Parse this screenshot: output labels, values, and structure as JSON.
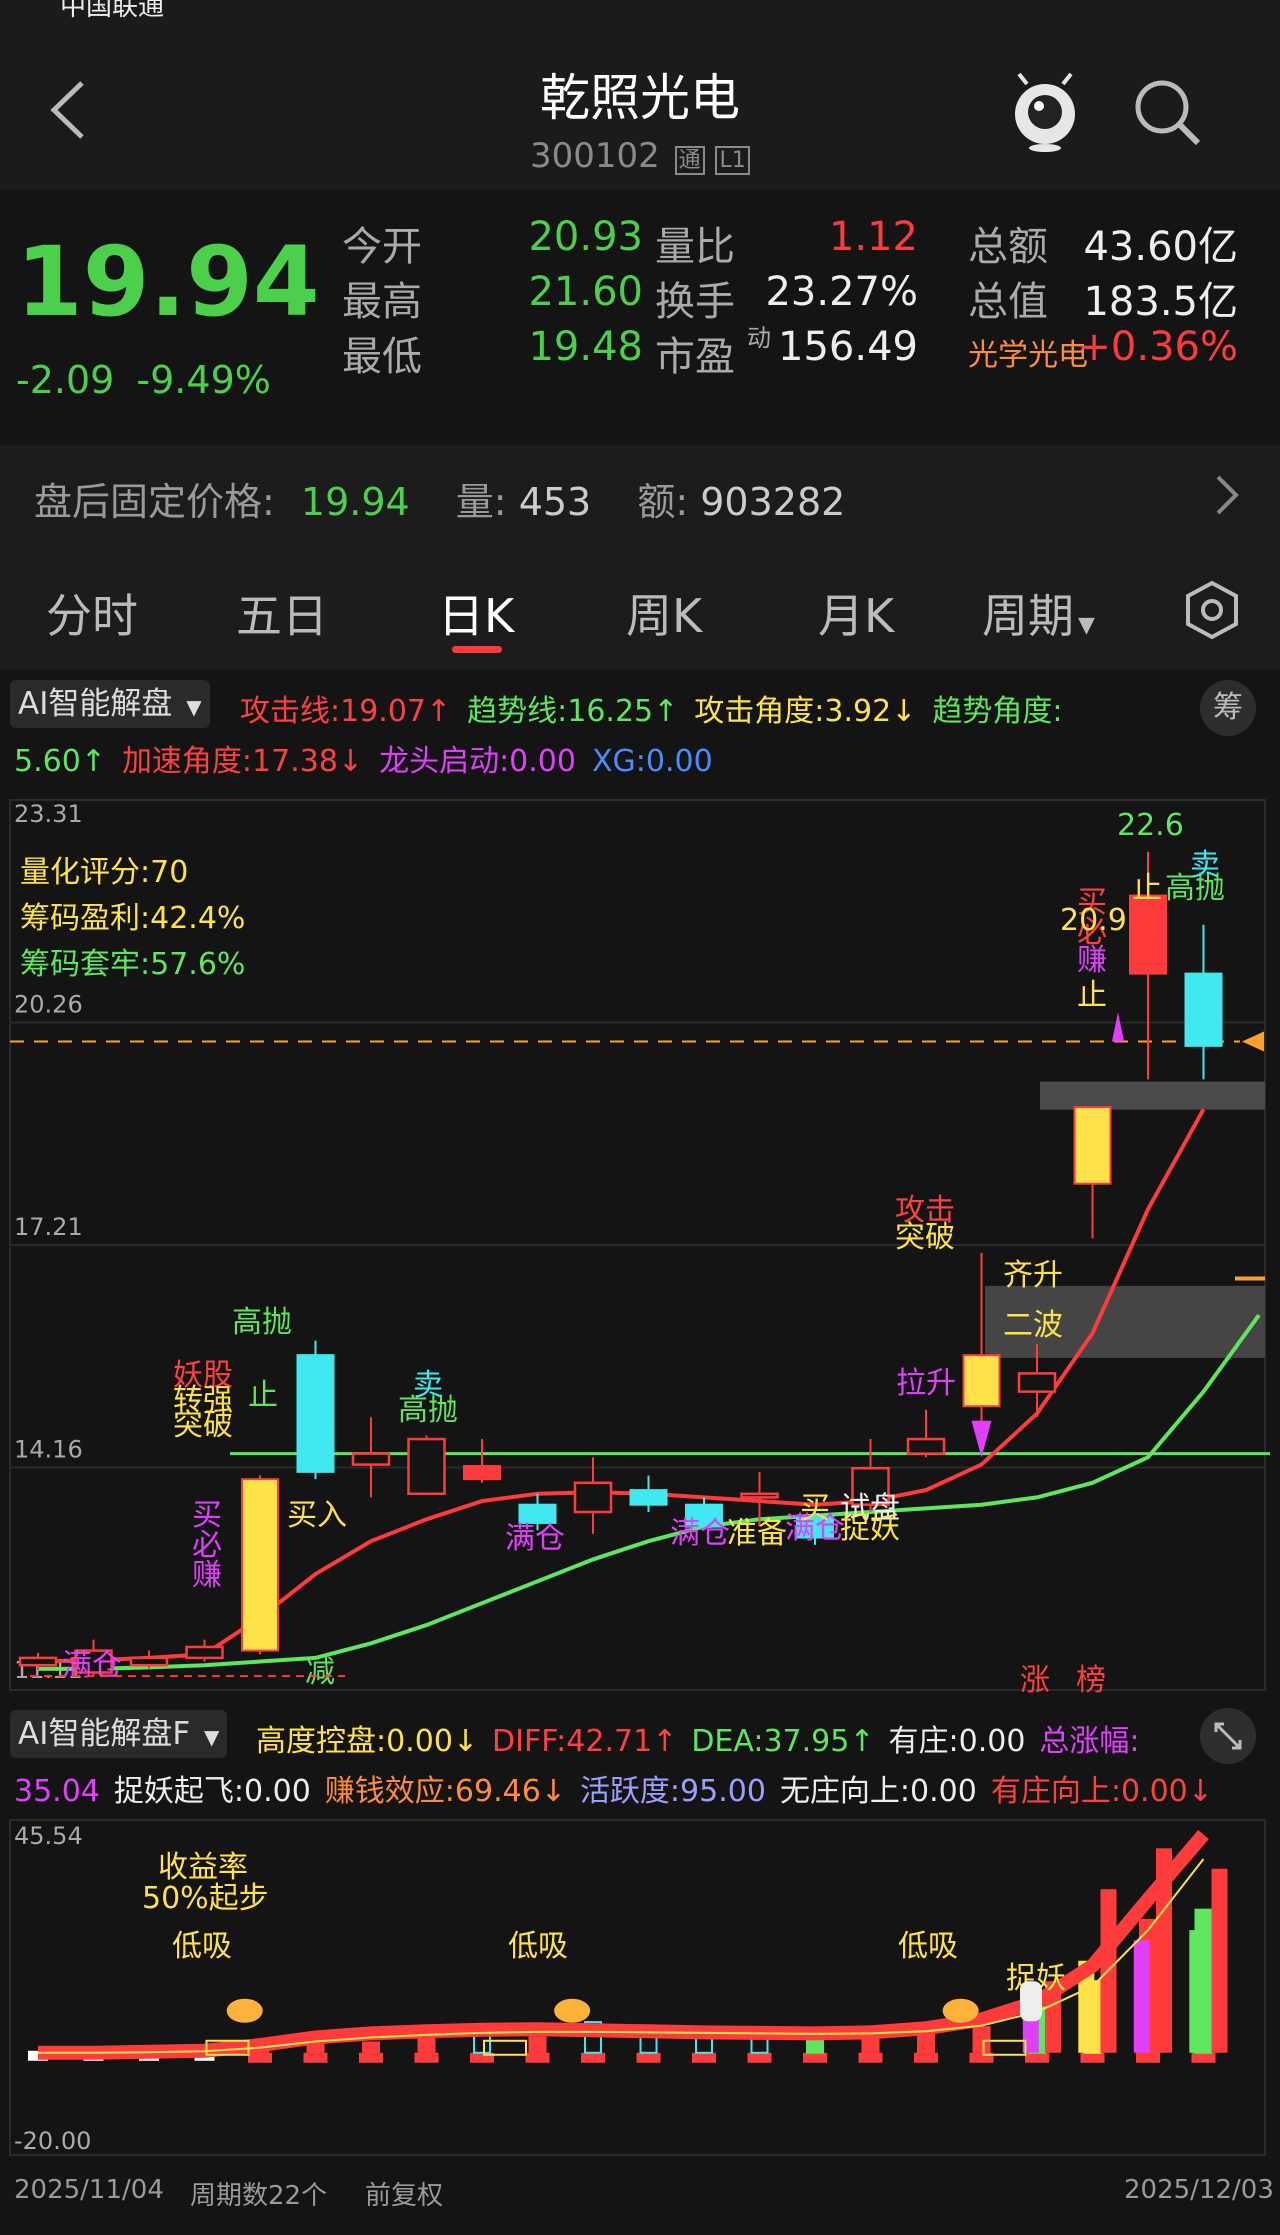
{
  "header": {
    "status_text": "中国联通",
    "title": "乾照光电",
    "code": "300102",
    "badge_tong": "通",
    "badge_level": "L1"
  },
  "quote": {
    "price": "19.94",
    "change": "-2.09",
    "change_pct": "-9.49%",
    "rows": [
      [
        {
          "label": "今开",
          "value": "20.93",
          "color": "#4cd04c"
        },
        {
          "label": "量比",
          "value": "1.12",
          "color": "#ff3b3b"
        },
        {
          "label": "总额",
          "value": "43.60亿",
          "color": "#eeeeee"
        }
      ],
      [
        {
          "label": "最高",
          "value": "21.60",
          "color": "#4cd04c"
        },
        {
          "label": "换手",
          "value": "23.27%",
          "color": "#eeeeee"
        },
        {
          "label": "总值",
          "value": "183.5亿",
          "color": "#eeeeee"
        }
      ],
      [
        {
          "label": "最低",
          "value": "19.48",
          "color": "#4cd04c"
        },
        {
          "label": "市盈",
          "label_sup": "动",
          "value": "156.49",
          "color": "#eeeeee"
        },
        {
          "label": "光学光电",
          "value": "+0.36%",
          "color": "#ff3b3b"
        }
      ]
    ]
  },
  "after_hours": {
    "label": "盘后固定价格:",
    "price": "19.94",
    "vol_label": "量:",
    "vol": "453",
    "amt_label": "额:",
    "amt": "903282"
  },
  "tabs": [
    {
      "label": "分时",
      "active": false
    },
    {
      "label": "五日",
      "active": false
    },
    {
      "label": "日K",
      "active": true
    },
    {
      "label": "周K",
      "active": false
    },
    {
      "label": "月K",
      "active": false
    },
    {
      "label": "周期",
      "active": false,
      "dropdown": true
    }
  ],
  "indicator1": {
    "selector": "AI智能解盘",
    "chip_icon": "筹",
    "line1": [
      {
        "text": "攻击线:19.07↑",
        "color": "#ff4040"
      },
      {
        "text": "趋势线:16.25↑",
        "color": "#5ee65e"
      },
      {
        "text": "攻击角度:3.92↓",
        "color": "#ffe24a"
      },
      {
        "text": "趋势角度:",
        "color": "#5ee65e"
      }
    ],
    "line2": [
      {
        "text": "5.60↑",
        "color": "#5ee65e"
      },
      {
        "text": "加速角度:17.38↓",
        "color": "#ff4040"
      },
      {
        "text": "龙头启动:0.00",
        "color": "#e040fb"
      },
      {
        "text": "XG:0.00",
        "color": "#4a8cff"
      }
    ]
  },
  "kline": {
    "axis_labels": [
      "23.31",
      "20.26",
      "17.21",
      "14.16",
      "11.11"
    ],
    "stats": [
      {
        "text": "量化评分:70",
        "color": "#ffe24a"
      },
      {
        "text": "筹码盈利:42.4%",
        "color": "#ffe24a"
      },
      {
        "text": "筹码套牢:57.6%",
        "color": "#5ee65e"
      }
    ],
    "candles": [
      {
        "o": 11.45,
        "c": 11.55,
        "h": 11.62,
        "l": 11.38
      },
      {
        "o": 11.35,
        "c": 11.65,
        "h": 11.8,
        "l": 11.3
      },
      {
        "o": 11.45,
        "c": 11.55,
        "h": 11.65,
        "l": 11.4
      },
      {
        "o": 11.55,
        "c": 11.7,
        "h": 11.8,
        "l": 11.5
      },
      {
        "o": 11.65,
        "c": 14.0,
        "h": 14.05,
        "l": 11.6
      },
      {
        "o": 14.1,
        "c": 15.7,
        "h": 15.9,
        "l": 14.0
      },
      {
        "o": 14.2,
        "c": 14.35,
        "h": 14.85,
        "l": 13.75
      },
      {
        "o": 13.8,
        "c": 14.55,
        "h": 14.6,
        "l": 13.8
      },
      {
        "o": 14.18,
        "c": 14.0,
        "h": 14.55,
        "l": 13.95
      },
      {
        "o": 13.65,
        "c": 13.4,
        "h": 13.8,
        "l": 13.3
      },
      {
        "o": 13.55,
        "c": 13.95,
        "h": 14.3,
        "l": 13.25
      },
      {
        "o": 13.85,
        "c": 13.65,
        "h": 14.05,
        "l": 13.55
      },
      {
        "o": 13.65,
        "c": 13.35,
        "h": 13.75,
        "l": 13.3
      },
      {
        "o": 13.75,
        "c": 13.8,
        "h": 14.1,
        "l": 13.35
      },
      {
        "o": 13.5,
        "c": 13.2,
        "h": 13.6,
        "l": 13.1
      },
      {
        "o": 13.65,
        "c": 14.15,
        "h": 14.55,
        "l": 13.55
      },
      {
        "o": 14.35,
        "c": 14.55,
        "h": 14.95,
        "l": 14.3
      },
      {
        "o": 15.0,
        "c": 15.7,
        "h": 17.1,
        "l": 14.75
      },
      {
        "o": 15.2,
        "c": 15.45,
        "h": 15.85,
        "l": 14.85
      },
      {
        "o": 18.05,
        "c": 19.1,
        "h": 19.1,
        "l": 17.3
      },
      {
        "o": 20.93,
        "c": 22.0,
        "h": 22.6,
        "l": 19.48
      },
      {
        "o": 20.93,
        "c": 19.94,
        "h": 21.6,
        "l": 19.48
      }
    ],
    "attack_line": [
      11.5,
      11.52,
      11.55,
      11.6,
      12.1,
      12.7,
      13.15,
      13.45,
      13.7,
      13.8,
      13.82,
      13.8,
      13.75,
      13.7,
      13.65,
      13.7,
      13.85,
      14.2,
      14.9,
      16.0,
      17.7,
      19.07
    ],
    "trend_line": [
      11.4,
      11.42,
      11.45,
      11.5,
      11.55,
      11.75,
      12.0,
      12.3,
      12.6,
      12.9,
      13.15,
      13.35,
      13.45,
      13.5,
      13.55,
      13.6,
      13.65,
      13.75,
      13.95,
      14.3,
      15.2,
      16.25
    ],
    "dashed_price": 20.0,
    "bottom_label": "减",
    "bottom_tags": [
      "涨",
      "榜"
    ]
  },
  "indicator2": {
    "selector": "AI智能解盘F",
    "expand_icon": "expand-icon",
    "line1": [
      {
        "text": "高度控盘:0.00↓",
        "color": "#ffe24a"
      },
      {
        "text": "DIFF:42.71↑",
        "color": "#ff4040"
      },
      {
        "text": "DEA:37.95↑",
        "color": "#5ee65e"
      },
      {
        "text": "有庄:0.00",
        "color": "#eeeeee"
      },
      {
        "text": "总涨幅:",
        "color": "#e040fb"
      }
    ],
    "line2": [
      {
        "text": "35.04",
        "color": "#e040fb"
      },
      {
        "text": "捉妖起飞:0.00",
        "color": "#eeeeee"
      },
      {
        "text": "赚钱效应:69.46↓",
        "color": "#ff8c3a"
      },
      {
        "text": "活跃度:95.00",
        "color": "#9aa0ff"
      },
      {
        "text": "无庄向上:0.00",
        "color": "#eeeeee"
      },
      {
        "text": "有庄向上:0.00↓",
        "color": "#ff4040"
      }
    ]
  },
  "subchart": {
    "axis_labels": [
      "45.54",
      "-20.00"
    ],
    "labels": [
      {
        "text": "收益率",
        "color": "#ffe24a"
      },
      {
        "text": "50%起步",
        "color": "#ffe24a"
      },
      {
        "text": "低吸",
        "color": "#ffe24a"
      },
      {
        "text": "低吸",
        "color": "#ffe24a"
      },
      {
        "text": "低吸",
        "color": "#ffe24a"
      },
      {
        "text": "捉妖",
        "color": "#ffe24a"
      },
      {
        "text": "卖",
        "color": "#40e0ff"
      },
      {
        "text": "买",
        "color": "#ffe24a"
      },
      {
        "text": "卖",
        "color": "#40e0ff"
      }
    ]
  },
  "footer": {
    "start_date": "2025/11/04",
    "period_count": "周期数22个",
    "adjust": "前复权",
    "end_date": "2025/12/03"
  },
  "colors": {
    "up": "#ff3b3b",
    "down": "#40e8f0",
    "bull_fill": "#ffe24a"
  }
}
